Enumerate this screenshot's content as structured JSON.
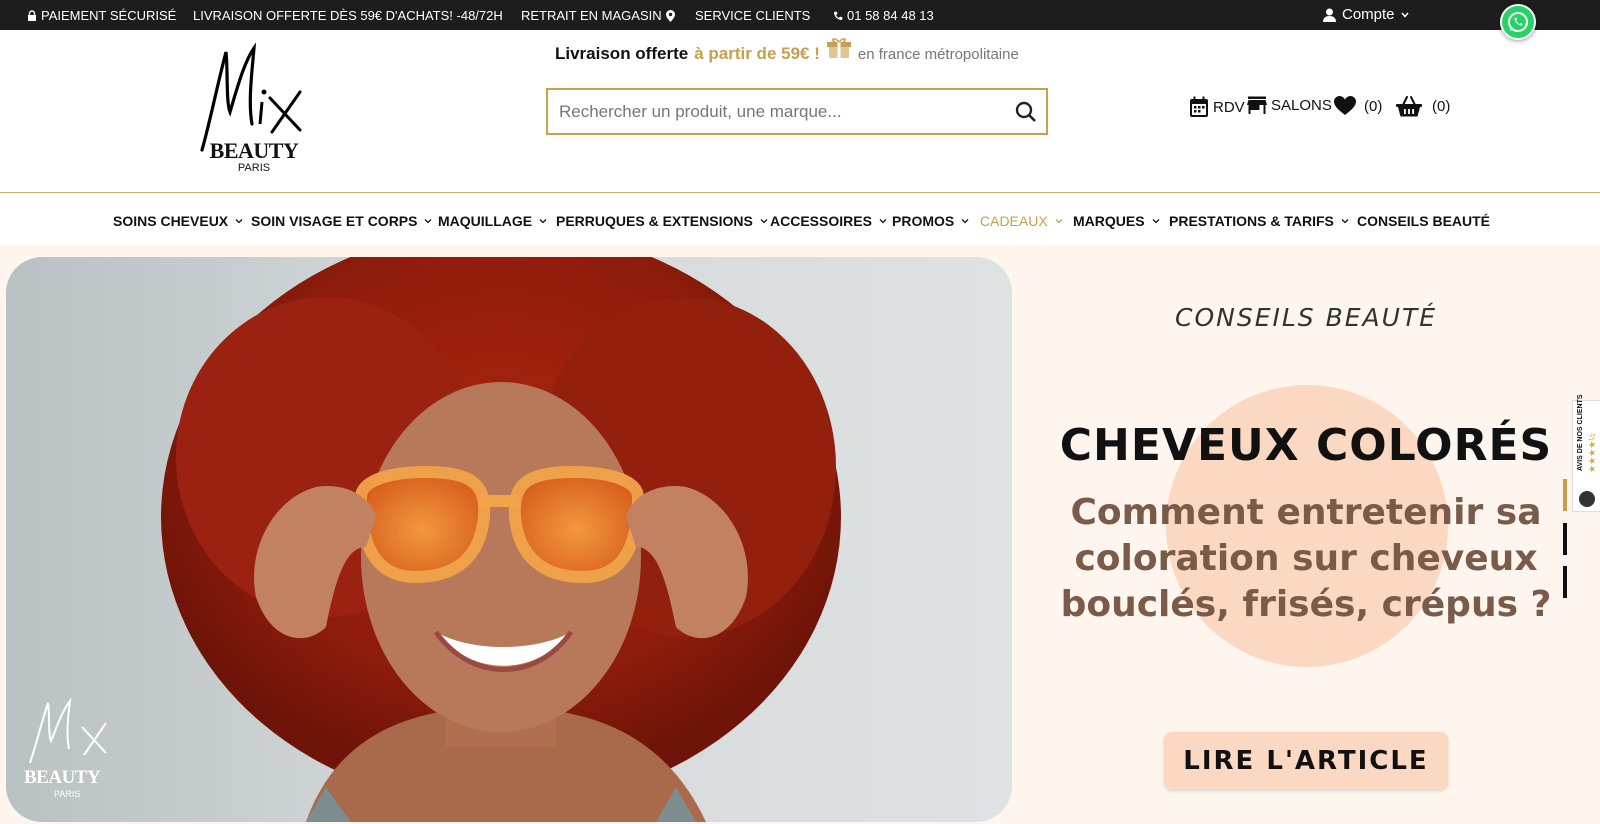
{
  "topbar": {
    "secure": "PAIEMENT SÉCURISÉ",
    "delivery": "LIVRAISON OFFERTE DÈS 59€ D'ACHATS! -48/72H",
    "store_pickup": "RETRAIT EN MAGASIN",
    "service": "SERVICE CLIENTS",
    "phone": "01 58 84 48 13",
    "account": "Compte"
  },
  "brand": {
    "logo_script": "Mix",
    "logo_name": "BEAUTY",
    "logo_city": "PARIS"
  },
  "promo": {
    "part1": "Livraison offerte",
    "part2": "à partir de 59€ !",
    "part3": "en france métropolitaine"
  },
  "search": {
    "placeholder": "Rechercher un produit, une marque..."
  },
  "header_icons": {
    "rdv": "RDV",
    "salons": "SALONS",
    "wishlist_count": "(0)",
    "cart_count": "(0)"
  },
  "nav": [
    {
      "label": "SOINS CHEVEUX"
    },
    {
      "label": "SOIN VISAGE ET CORPS"
    },
    {
      "label": "MAQUILLAGE"
    },
    {
      "label": "PERRUQUES & EXTENSIONS"
    },
    {
      "label": "ACCESSOIRES"
    },
    {
      "label": "PROMOS"
    },
    {
      "label": "CADEAUX"
    },
    {
      "label": "MARQUES"
    },
    {
      "label": "PRESTATIONS & TARIFS"
    },
    {
      "label": "CONSEILS BEAUTÉ"
    }
  ],
  "hero": {
    "kicker": "CONSEILS BEAUTÉ",
    "title": "CHEVEUX COLORÉS",
    "subtitle": "Comment entretenir sa coloration sur cheveux bouclés, frisés, crépus ?",
    "cta": "LIRE L'ARTICLE",
    "watermark_script": "Mix",
    "watermark_name": "BEAUTY",
    "watermark_city": "PARIS"
  },
  "reviews_widget": {
    "label": "AVIS DE NOS CLIENTS",
    "stars": "★★★★½"
  },
  "colors": {
    "gold": "#c7a04f",
    "topbar": "#1d1d1d",
    "hero_bg": "#fdf5ee",
    "peach": "#fbd8c1",
    "subtitle": "#7a5a48"
  },
  "icons": [
    "lock-icon",
    "map-pin-icon",
    "phone-icon",
    "user-icon",
    "chevron-down-icon",
    "whatsapp-icon",
    "gift-icon",
    "search-icon",
    "calendar-icon",
    "store-icon",
    "heart-icon",
    "basket-icon"
  ]
}
